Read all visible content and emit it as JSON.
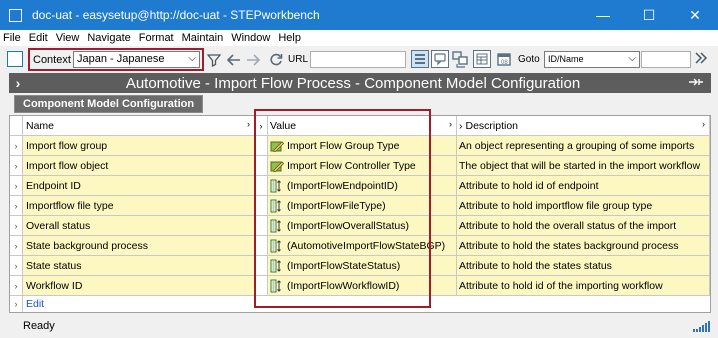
{
  "window": {
    "title": "doc-uat - easysetup@http://doc-uat - STEPworkbench",
    "controls": {
      "minimize": "—",
      "maximize": "☐",
      "close": "✕"
    }
  },
  "menu": [
    "File",
    "Edit",
    "View",
    "Navigate",
    "Format",
    "Maintain",
    "Window",
    "Help"
  ],
  "toolbar": {
    "context_label": "Context",
    "context_value": "Japan - Japanese",
    "url_label": "URL",
    "goto_label": "Goto",
    "goto_value": "ID/Name",
    "goto_input": ""
  },
  "page": {
    "title": "Automotive - Import Flow Process - Component Model Configuration",
    "tab": "Component Model Configuration"
  },
  "grid": {
    "columns": {
      "name": "Name",
      "value": "Value",
      "description": "Description"
    },
    "rows": [
      {
        "name": "Import flow group",
        "value": "Import Flow Group Type",
        "icon": "object-type-icon",
        "description": "An object representing a grouping of some imports"
      },
      {
        "name": "Import flow object",
        "value": "Import Flow Controller Type",
        "icon": "object-type-icon",
        "description": "The object that will be started in the import workflow"
      },
      {
        "name": "Endpoint ID",
        "value": "(ImportFlowEndpointID)",
        "icon": "attribute-icon",
        "description": "Attribute to hold id of endpoint"
      },
      {
        "name": "Importflow file type",
        "value": "(ImportFlowFileType)",
        "icon": "attribute-icon",
        "description": "Attribute to hold importflow file group type"
      },
      {
        "name": "Overall status",
        "value": "(ImportFlowOverallStatus)",
        "icon": "attribute-icon",
        "description": "Attribute to hold the overall status of the import"
      },
      {
        "name": "State background process",
        "value": "(AutomotiveImportFlowStateBGP)",
        "icon": "attribute-icon",
        "description": "Attribute to hold the states background process"
      },
      {
        "name": "State status",
        "value": "(ImportFlowStateStatus)",
        "icon": "attribute-icon",
        "description": "Attribute to hold the states status"
      },
      {
        "name": "Workflow ID",
        "value": "(ImportFlowWorkflowID)",
        "icon": "attribute-icon",
        "description": "Attribute to hold id of the importing workflow"
      }
    ],
    "edit_label": "Edit"
  },
  "status": {
    "text": "Ready"
  },
  "colors": {
    "titlebar": "#1e7bd0",
    "highlight": "#a11c2a",
    "row_background": "#fdf7c2",
    "header_band": "#5d5d5d"
  }
}
